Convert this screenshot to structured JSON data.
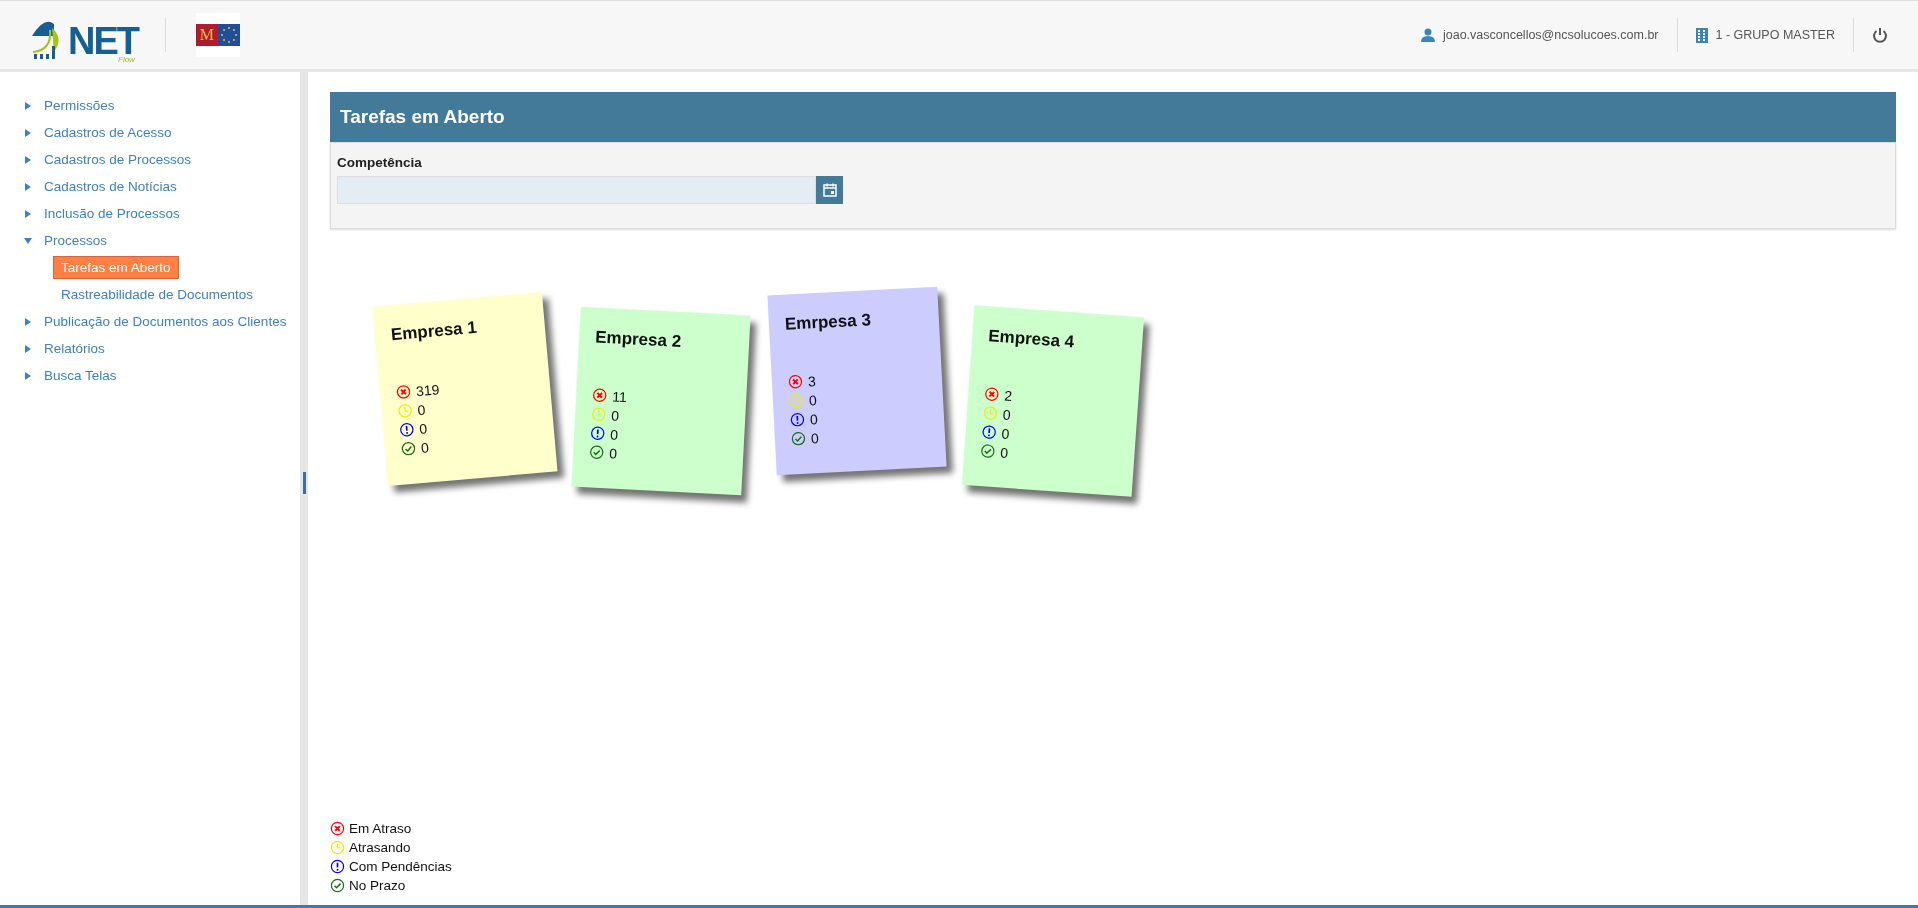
{
  "header": {
    "logo": {
      "name": "NET",
      "sub": "Flow"
    },
    "partner_logo": {
      "letter": "M"
    },
    "user": "joao.vasconcellos@ncsolucoes.com.br",
    "company": "1 - GRUPO MASTER"
  },
  "sidebar": {
    "items": [
      {
        "label": "Permissões",
        "expanded": false
      },
      {
        "label": "Cadastros de Acesso",
        "expanded": false
      },
      {
        "label": "Cadastros de Processos",
        "expanded": false
      },
      {
        "label": "Cadastros de Notícias",
        "expanded": false
      },
      {
        "label": "Inclusão de Processos",
        "expanded": false
      },
      {
        "label": "Processos",
        "expanded": true,
        "children": [
          {
            "label": "Tarefas em Aberto",
            "selected": true
          },
          {
            "label": "Rastreabilidade de Documentos",
            "selected": false
          }
        ]
      },
      {
        "label": "Publicação de Documentos aos Clientes",
        "expanded": false
      },
      {
        "label": "Relatórios",
        "expanded": false
      },
      {
        "label": "Busca Telas",
        "expanded": false
      }
    ]
  },
  "panel": {
    "title": "Tarefas em Aberto",
    "field": {
      "label": "Competência"
    }
  },
  "cards": [
    {
      "title": "Empresa 1",
      "color": "#ffffcc",
      "counts": [
        {
          "kind": "late",
          "value": "319"
        },
        {
          "kind": "delaying",
          "value": "0"
        },
        {
          "kind": "pending",
          "value": "0"
        },
        {
          "kind": "ontime",
          "value": "0"
        }
      ]
    },
    {
      "title": "Empresa 2",
      "color": "#ccffcc",
      "counts": [
        {
          "kind": "late",
          "value": "11"
        },
        {
          "kind": "delaying",
          "value": "0"
        },
        {
          "kind": "pending",
          "value": "0"
        },
        {
          "kind": "ontime",
          "value": "0"
        }
      ]
    },
    {
      "title": "Emrpesa 3",
      "color": "#ccccff",
      "counts": [
        {
          "kind": "late",
          "value": "3"
        },
        {
          "kind": "delaying",
          "value": "0"
        },
        {
          "kind": "pending",
          "value": "0"
        },
        {
          "kind": "ontime",
          "value": "0"
        }
      ]
    },
    {
      "title": "Empresa 4",
      "color": "#ccffcc",
      "counts": [
        {
          "kind": "late",
          "value": "2"
        },
        {
          "kind": "delaying",
          "value": "0"
        },
        {
          "kind": "pending",
          "value": "0"
        },
        {
          "kind": "ontime",
          "value": "0"
        }
      ]
    }
  ],
  "legend": [
    {
      "kind": "late",
      "label": "Em Atraso"
    },
    {
      "kind": "delaying",
      "label": "Atrasando"
    },
    {
      "kind": "pending",
      "label": "Com Pendências"
    },
    {
      "kind": "ontime",
      "label": "No Prazo"
    }
  ]
}
